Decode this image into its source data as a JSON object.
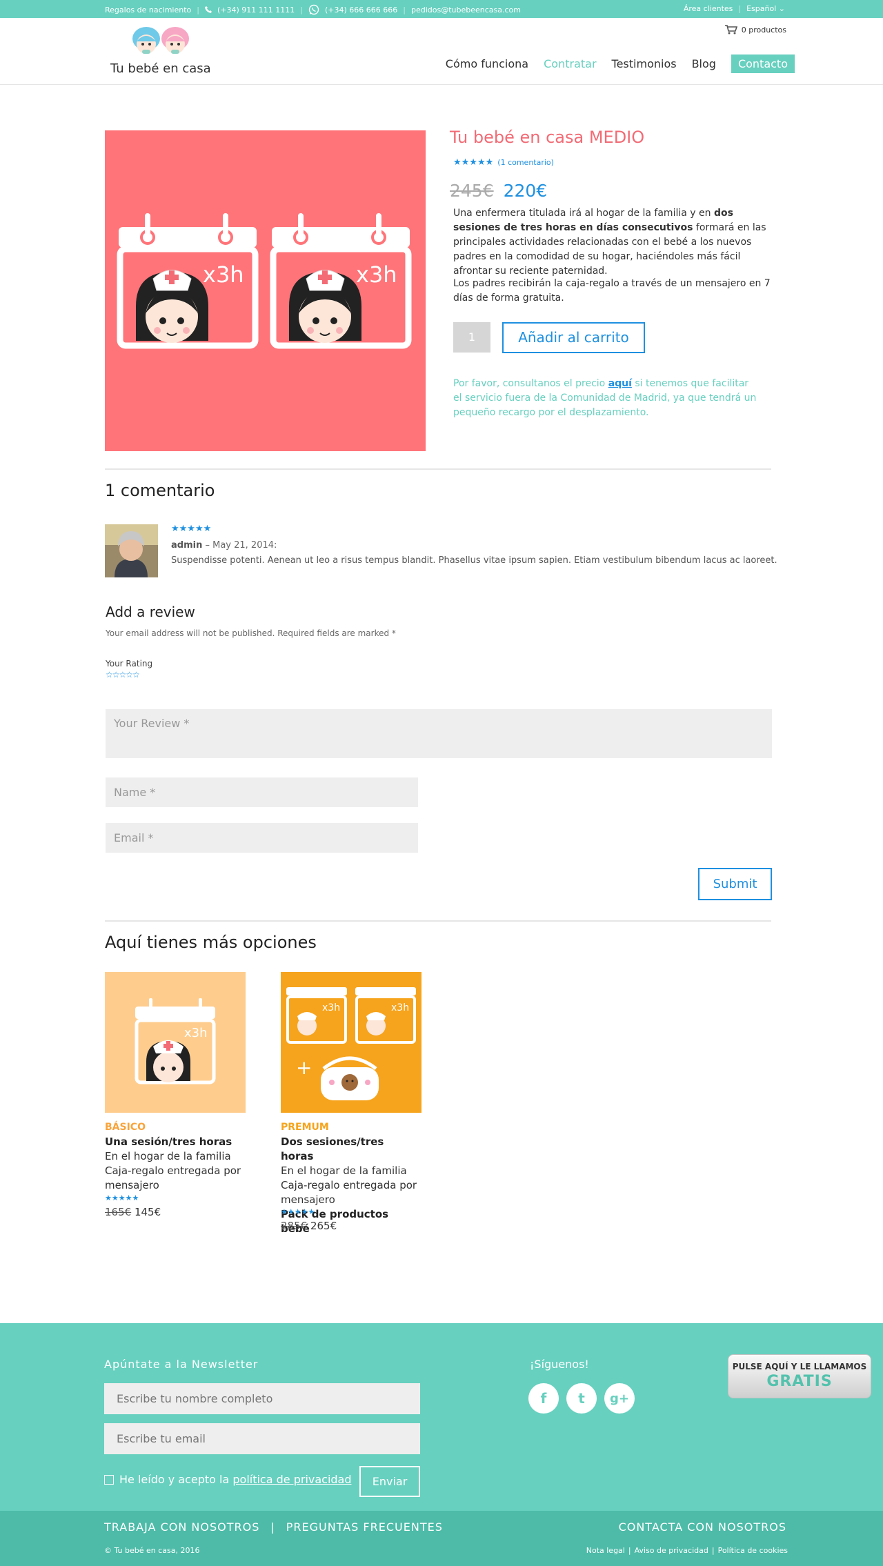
{
  "topbar": {
    "gifts": "Regalos de nacimiento",
    "phone": "(+34) 911 111 1111",
    "whatsapp": "(+34) 666 666 666",
    "email": "pedidos@tubebeencasa.com",
    "clients": "Área clientes",
    "language": "Español"
  },
  "header": {
    "logo_text": "Tu bebé en casa",
    "cart": "0 productos",
    "nav": [
      "Cómo funciona",
      "Contratar",
      "Testimonios",
      "Blog",
      "Contacto"
    ]
  },
  "product": {
    "title": "Tu bebé en casa MEDIO",
    "rating_link": "(1 comentario)",
    "price_old": "245€",
    "price_new": "220€",
    "desc_a": "Una enfermera titulada irá al hogar de la familia y en ",
    "desc_bold": "dos sesiones de tres horas en días consecutivos",
    "desc_b": " formará en las principales actividades relacionadas con el bebé a los nuevos padres en la comodidad de su hogar, haciéndoles más fácil afrontar su reciente paternidad.",
    "desc2": "Los padres recibirán la caja-regalo a través de un mensajero en 7 días de forma gratuita.",
    "qty": "1",
    "add_to_cart": "Añadir al carrito",
    "note_a": "Por favor, consultanos el precio ",
    "note_link": "aquí",
    "note_b": " si tenemos que facilitar el servicio fuera de la Comunidad de Madrid, ya que tendrá un pequeño recargo por el desplazamiento.",
    "badge": "x3h"
  },
  "comments": {
    "title": "1 comentario",
    "author": "admin",
    "date": " – May 21, 2014:",
    "text": "Suspendisse potenti. Aenean ut leo a risus tempus blandit. Phasellus vitae ipsum sapien. Etiam vestibulum bibendum lacus ac laoreet.",
    "stars": "★★★★★"
  },
  "review": {
    "title": "Add a review",
    "note": "Your email address will not be published. Required fields are marked *",
    "rating_label": "Your Rating",
    "rating_stars": "☆☆☆☆☆",
    "review_placeholder": "Your Review *",
    "name_placeholder": "Name *",
    "email_placeholder": "Email *",
    "submit": "Submit"
  },
  "more": {
    "title": "Aquí tienes más opciones",
    "cards": [
      {
        "category": "BÁSICO",
        "category_color": "#f9a33a",
        "line1": "Una sesión/tres horas",
        "line2": "En el hogar de la familia",
        "line3": "Caja-regalo entregada por",
        "line4": "mensajero",
        "stars": "★★★★★",
        "old_price": "165€",
        "new_price": "145€"
      },
      {
        "category": "PREMUM",
        "category_color": "#f5a31a",
        "line1": "Dos sesiones/tres horas",
        "line2": "En el hogar de la familia",
        "line3": "Caja-regalo entregada por",
        "line4": "mensajero",
        "line5": "Pack de productos bebé",
        "stars": "★★★★★",
        "old_price": "285€",
        "new_price": "265€"
      }
    ]
  },
  "footer": {
    "newsletter_title": "Apúntate a la Newsletter",
    "name_placeholder": "Escribe tu nombre completo",
    "email_placeholder": "Escribe tu email",
    "privacy_a": "He leído y acepto la ",
    "privacy_link": "política de privacidad",
    "send": "Enviar",
    "follow": "¡Síguenos!",
    "social": [
      "f",
      "t",
      "g+"
    ],
    "call_line1": "PULSE AQUÍ Y LE LLAMAMOS",
    "call_line2": "GRATIS",
    "links": [
      "TRABAJA CON NOSOTROS",
      "|",
      "PREGUNTAS FRECUENTES"
    ],
    "contact": "CONTACTA CON NOSOTROS",
    "copyright": "© Tu bebé en casa, 2016",
    "legal": [
      "Nota legal",
      "|",
      "Aviso de privacidad",
      "|",
      "Política de cookies"
    ]
  },
  "colors": {
    "accent": "#67d0bf",
    "product_bg": "#ff7479",
    "link_blue": "#1e90e0",
    "title_pink": "#f26b75"
  }
}
